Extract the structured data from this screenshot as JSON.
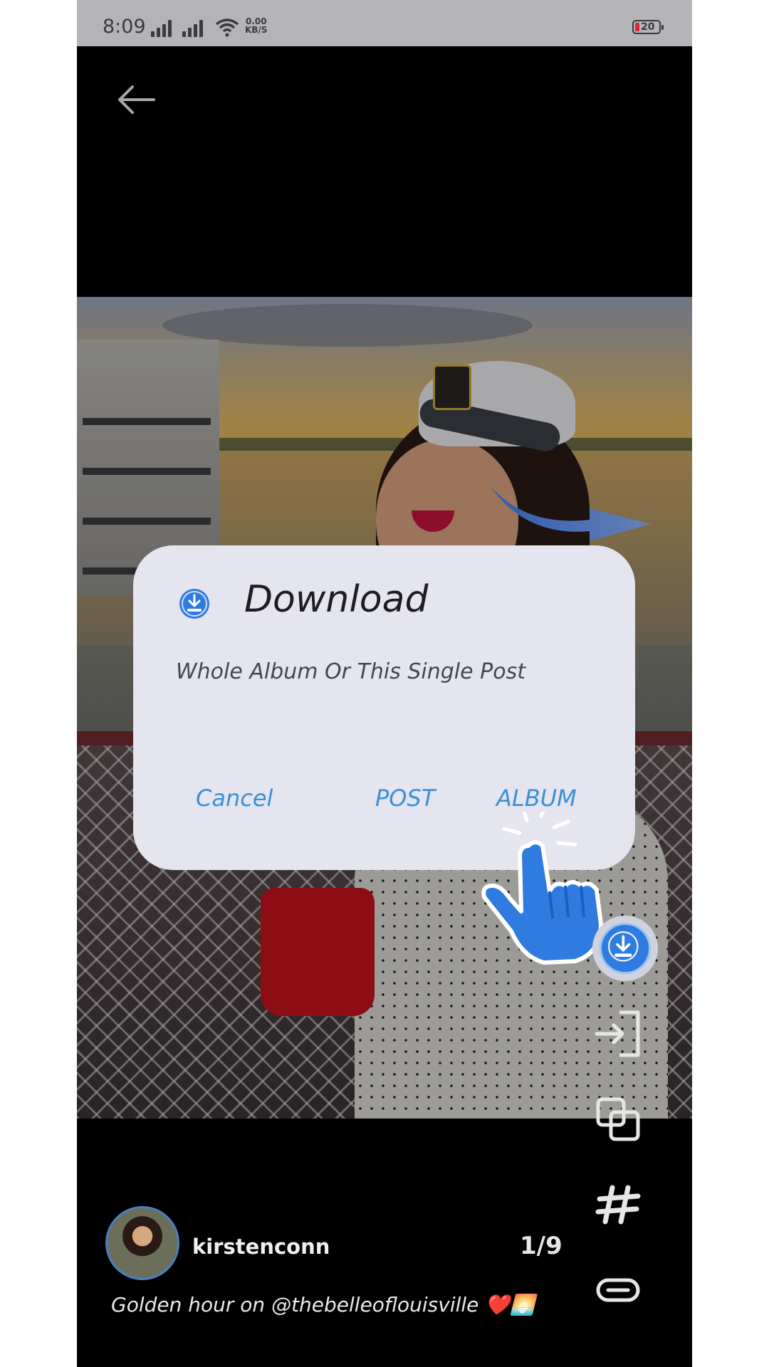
{
  "status_bar": {
    "time": "8:09",
    "net_speed_value": "0.00",
    "net_speed_unit": "KB/S",
    "battery_level": "20"
  },
  "dialog": {
    "title": "Download",
    "message": "Whole Album Or This Single Post",
    "cancel_label": "Cancel",
    "post_label": "POST",
    "album_label": "ALBUM"
  },
  "post": {
    "username": "kirstenconn",
    "counter": "1/9",
    "caption": "Golden hour on @thebelleoflouisville ❤️🌅"
  },
  "icons": {
    "back": "arrow-left-icon",
    "download": "download-icon",
    "repost": "enter-icon",
    "copy": "copy-icon",
    "hashtag": "hashtag-icon",
    "link": "link-icon"
  },
  "colors": {
    "accent": "#3c8fd8",
    "dialog_bg": "#e4e5ef",
    "download_blue": "#2f7be0"
  }
}
